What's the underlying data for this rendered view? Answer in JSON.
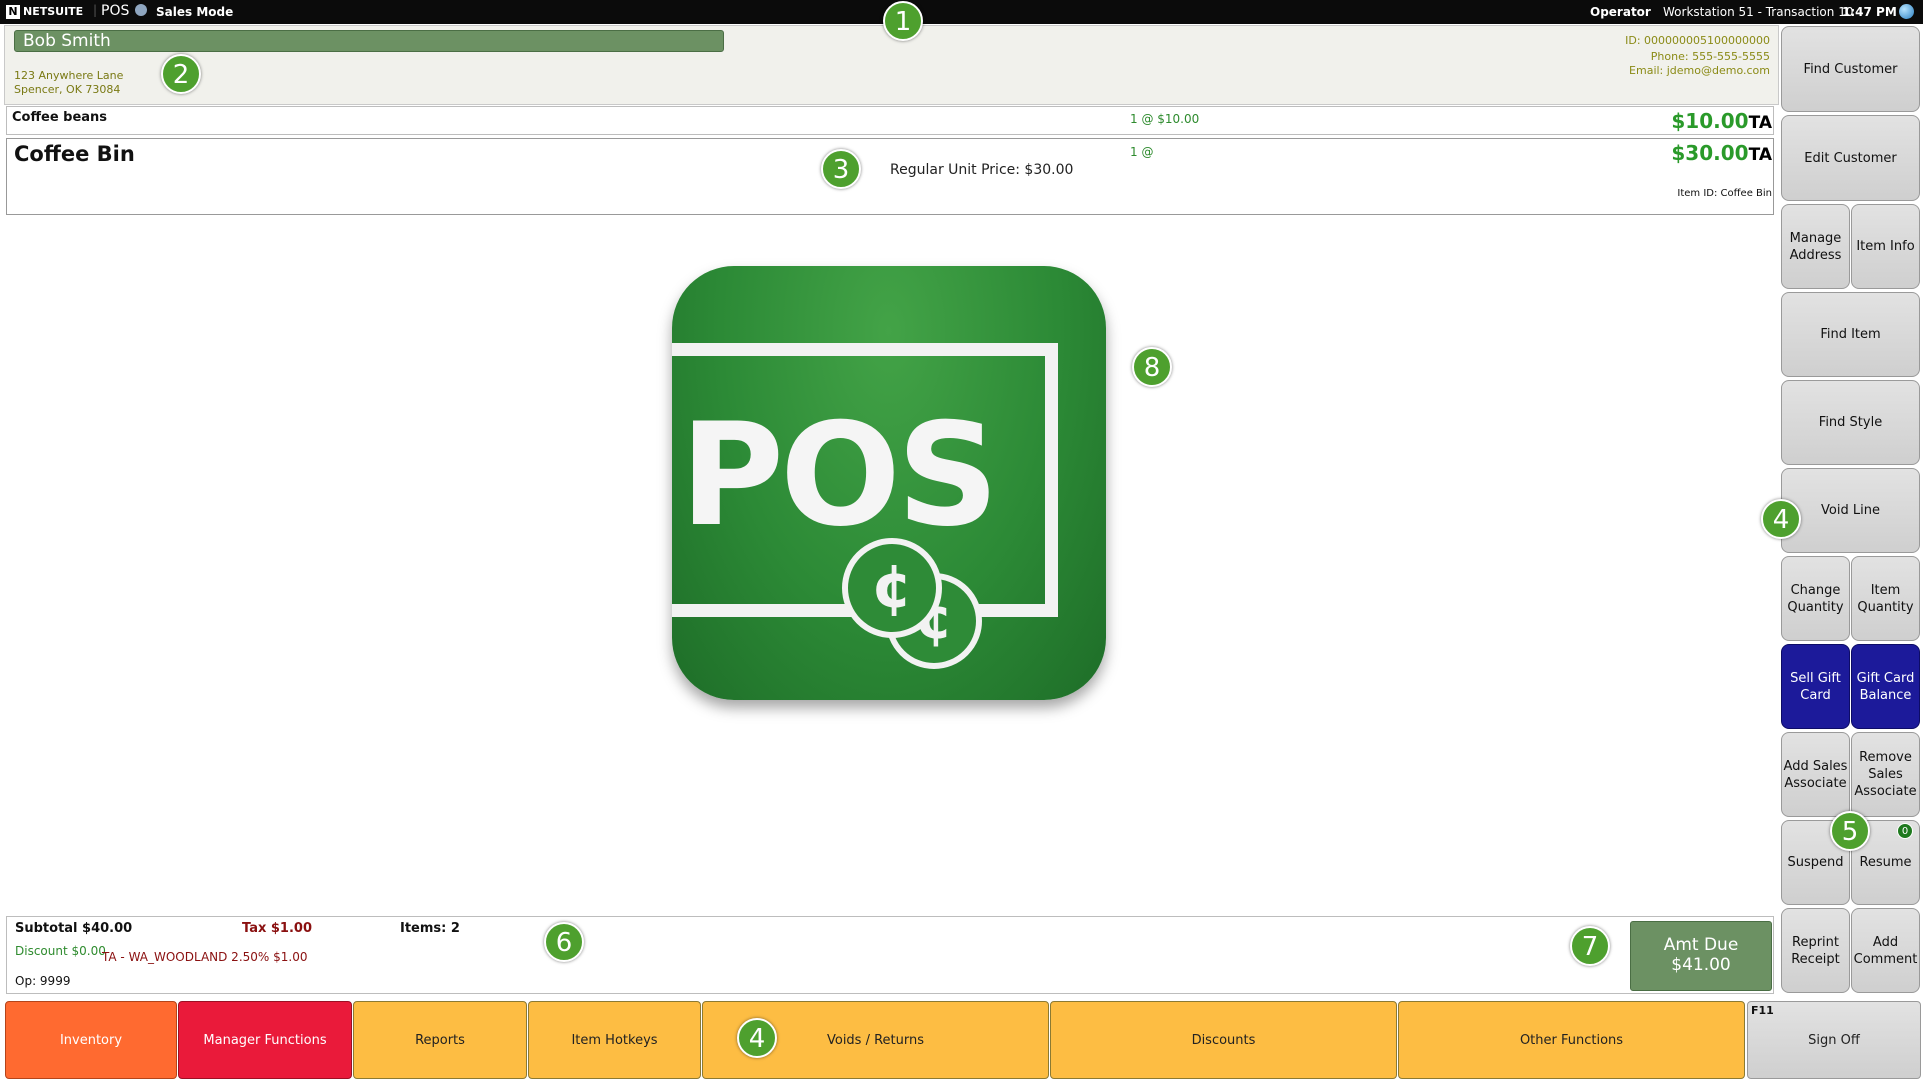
{
  "topbar": {
    "logo_mark": "N",
    "brand": "NETSUITE",
    "app": "POS",
    "mode": "Sales Mode",
    "operator": "Operator",
    "workstation": "Workstation 51 - Transaction 10",
    "time": "1:47 PM",
    "status_icon": "globe-icon"
  },
  "customer": {
    "name": "Bob Smith",
    "address_line1": "123 Anywhere Lane",
    "address_line2": "Spencer, OK  73084",
    "id": "ID: 000000005100000000",
    "phone": "Phone: 555-555-5555",
    "email": "Email: jdemo@demo.com"
  },
  "lines": [
    {
      "name": "Coffee beans",
      "qty": "1 @ $10.00",
      "amount": "$10.00",
      "tax_code": "TA"
    },
    {
      "name": "Coffee Bin",
      "qty": "1 @",
      "regular_price": "Regular Unit Price: $30.00",
      "amount": "$30.00",
      "tax_code": "TA",
      "item_id": "Item ID: Coffee Bin"
    }
  ],
  "logo": {
    "text": "POS",
    "coin_symbol": "¢",
    "bg_color": "#2c8a36"
  },
  "right_buttons": {
    "find_customer": "Find Customer",
    "edit_customer": "Edit Customer",
    "manage_address": "Manage Address",
    "item_info": "Item Info",
    "find_item": "Find Item",
    "find_style": "Find Style",
    "void_line": "Void Line",
    "change_quantity": "Change Quantity",
    "item_quantity": "Item Quantity",
    "sell_gift_card": "Sell Gift Card",
    "gift_card_balance": "Gift Card Balance",
    "add_sales_associate": "Add Sales Associate",
    "remove_sales_associate": "Remove Sales Associate",
    "suspend": "Suspend",
    "resume": "Resume",
    "resume_badge": "0",
    "reprint_receipt": "Reprint Receipt",
    "add_comment": "Add Comment"
  },
  "summary": {
    "subtotal": "Subtotal $40.00",
    "tax": "Tax $1.00",
    "items": "Items: 2",
    "discount": "Discount $0.00",
    "tax_detail": "TA - WA_WOODLAND 2.50% $1.00",
    "operator": "Op: 9999",
    "amt_due_label": "Amt Due",
    "amt_due_value": "$41.00"
  },
  "bottom_buttons": {
    "inventory": "Inventory",
    "manager_functions": "Manager Functions",
    "reports": "Reports",
    "item_hotkeys": "Item Hotkeys",
    "voids_returns": "Voids / Returns",
    "discounts": "Discounts",
    "other_functions": "Other Functions",
    "sign_off_key": "F11",
    "sign_off": "Sign Off"
  },
  "markers": [
    "1",
    "2",
    "3",
    "4",
    "5",
    "6",
    "7",
    "4",
    "8"
  ],
  "colors": {
    "inventory": "#ff6a30",
    "manager_functions": "#ea1a3a",
    "function_yellow": "#fdbd43",
    "gift_blue": "#1c1a9a",
    "amount_green": "#2a9a2a",
    "marker_green": "#4ea02e"
  }
}
